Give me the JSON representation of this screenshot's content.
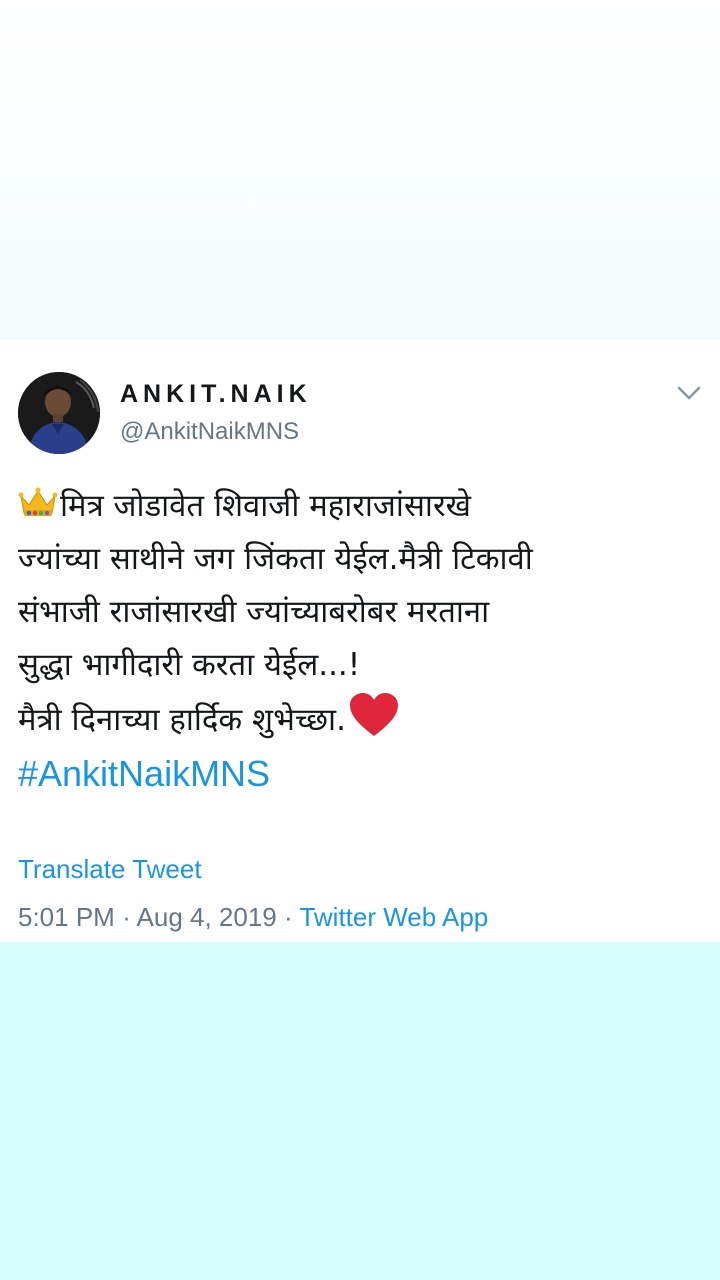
{
  "tweet": {
    "display_name": "ANKIT.NAIK",
    "handle": "@AnkitNaikMNS",
    "text_lines": [
      "मित्र जोडावेत शिवाजी महाराजांसारखे",
      "ज्यांच्या साथीने जग जिंकता येईल.मैत्री टिकावी",
      "संभाजी  राजांसारखी ज्यांच्याबरोबर मरताना",
      "सुद्धा भागीदारी करता येईल...!",
      " मैत्री दिनाच्या हार्दिक शुभेच्छा."
    ],
    "hashtag": "#AnkitNaikMNS",
    "translate_label": "Translate Tweet",
    "time": "5:01 PM",
    "date": "Aug 4, 2019",
    "source": "Twitter Web App",
    "separator": "·",
    "icons": [
      "crown-icon",
      "heart-icon",
      "chevron-down-icon"
    ]
  },
  "colors": {
    "link": "#1b95e0",
    "secondary_text": "#657786",
    "primary_text": "#14171a",
    "bottom_background": "#d6feff"
  }
}
